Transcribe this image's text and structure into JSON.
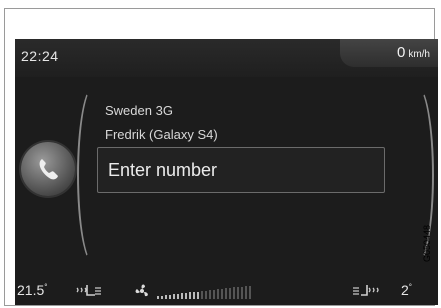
{
  "status": {
    "time": "22:24",
    "speed_value": "0",
    "speed_unit": "km/h"
  },
  "phone": {
    "network": "Sweden 3G",
    "device": "Fredrik (Galaxy S4)",
    "number_input_placeholder": "Enter number"
  },
  "climate": {
    "left_temp": "21.5",
    "left_temp_unit": "°",
    "right_temp": "2",
    "right_temp_unit": "°",
    "fan_level": 0.45
  },
  "figure_code": "G050448",
  "icons": {
    "phone": "phone-handset-icon",
    "seat_heat_left": "seat-heater-icon",
    "fan": "fan-icon",
    "seat_heat_right": "seat-heater-icon"
  }
}
